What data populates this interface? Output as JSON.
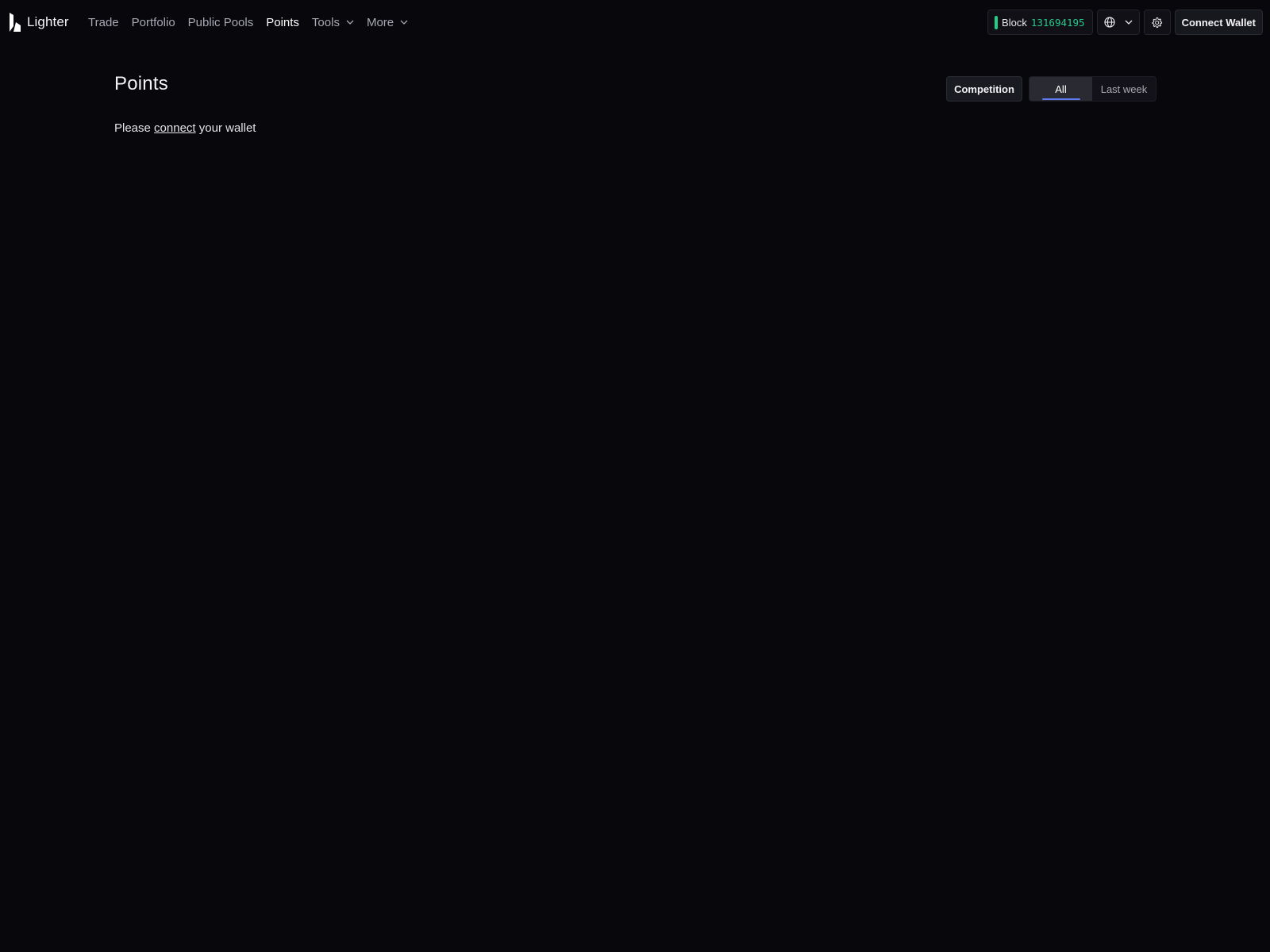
{
  "app": {
    "brand": "Lighter"
  },
  "nav": {
    "items": [
      {
        "label": "Trade",
        "active": false,
        "dropdown": false
      },
      {
        "label": "Portfolio",
        "active": false,
        "dropdown": false
      },
      {
        "label": "Public Pools",
        "active": false,
        "dropdown": false
      },
      {
        "label": "Points",
        "active": true,
        "dropdown": false
      },
      {
        "label": "Tools",
        "active": false,
        "dropdown": true
      },
      {
        "label": "More",
        "active": false,
        "dropdown": true
      }
    ]
  },
  "header": {
    "block_label": "Block",
    "block_number": "131694195",
    "language_icon": "globe-icon",
    "settings_icon": "gear-icon",
    "connect_wallet_label": "Connect Wallet"
  },
  "main": {
    "title": "Points",
    "message_prefix": "Please",
    "message_link": "connect",
    "message_suffix": "your wallet",
    "competition_label": "Competition",
    "period_options": [
      {
        "label": "All",
        "selected": true
      },
      {
        "label": "Last week",
        "selected": false
      }
    ]
  },
  "colors": {
    "background": "#07070c",
    "block_status": "#1fcf8a",
    "tab_underline": "#5f7cf5"
  }
}
